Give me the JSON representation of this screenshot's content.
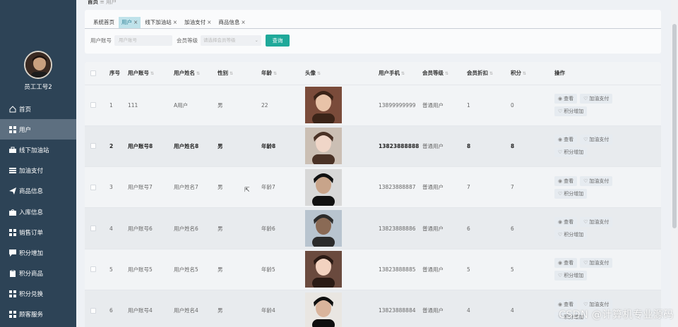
{
  "breadcrumb": {
    "home": "首页",
    "separator": "≡",
    "current": "用户"
  },
  "sidebar": {
    "username": "员工工号2",
    "items": [
      {
        "label": "首页",
        "icon": "home-icon",
        "active": false
      },
      {
        "label": "用户",
        "icon": "grid-icon",
        "active": true
      },
      {
        "label": "线下加油站",
        "icon": "briefcase-icon",
        "active": false
      },
      {
        "label": "加油支付",
        "icon": "list-icon",
        "active": false
      },
      {
        "label": "商品信息",
        "icon": "send-icon",
        "active": false
      },
      {
        "label": "入库信息",
        "icon": "bag-icon",
        "active": false
      },
      {
        "label": "销售订单",
        "icon": "grid-icon",
        "active": false
      },
      {
        "label": "积分增加",
        "icon": "chat-icon",
        "active": false
      },
      {
        "label": "积分商品",
        "icon": "clipboard-icon",
        "active": false
      },
      {
        "label": "积分兑换",
        "icon": "grid-icon",
        "active": false
      },
      {
        "label": "顾客服务",
        "icon": "grid-icon",
        "active": false
      }
    ]
  },
  "tabs": [
    {
      "label": "系统首页",
      "closable": false,
      "active": false
    },
    {
      "label": "用户",
      "closable": true,
      "active": true
    },
    {
      "label": "线下加油站",
      "closable": true,
      "active": false
    },
    {
      "label": "加油支付",
      "closable": true,
      "active": false
    },
    {
      "label": "商品信息",
      "closable": true,
      "active": false
    }
  ],
  "tab_close": "×",
  "search": {
    "account_label": "用户账号",
    "account_placeholder": "用户账号",
    "level_label": "会员等级",
    "level_placeholder": "请选择会员等级",
    "button": "查询"
  },
  "table": {
    "columns": [
      "序号",
      "用户账号",
      "用户姓名",
      "性别",
      "年龄",
      "头像",
      "用户手机",
      "会员等级",
      "会员折扣",
      "积分",
      "操作"
    ],
    "view_label": "查看",
    "pay_label": "加油支付",
    "points_label": "积分增加",
    "rows": [
      {
        "index": "1",
        "account": "111",
        "name": "A用户",
        "gender": "男",
        "age": "22",
        "phone": "13899999999",
        "level": "普通用户",
        "discount": "1",
        "points": "0"
      },
      {
        "index": "2",
        "account": "用户账号8",
        "name": "用户姓名8",
        "gender": "男",
        "age": "年龄8",
        "phone": "13823888888",
        "level": "普通用户",
        "discount": "8",
        "points": "8"
      },
      {
        "index": "3",
        "account": "用户账号7",
        "name": "用户姓名7",
        "gender": "男",
        "age": "年龄7",
        "phone": "13823888887",
        "level": "普通用户",
        "discount": "7",
        "points": "7"
      },
      {
        "index": "4",
        "account": "用户账号6",
        "name": "用户姓名6",
        "gender": "男",
        "age": "年龄6",
        "phone": "13823888886",
        "level": "普通用户",
        "discount": "6",
        "points": "6"
      },
      {
        "index": "5",
        "account": "用户账号5",
        "name": "用户姓名5",
        "gender": "男",
        "age": "年龄5",
        "phone": "13823888885",
        "level": "普通用户",
        "discount": "5",
        "points": "5"
      },
      {
        "index": "6",
        "account": "用户账号4",
        "name": "用户姓名4",
        "gender": "男",
        "age": "年龄4",
        "phone": "13823888884",
        "level": "普通用户",
        "discount": "4",
        "points": "4"
      }
    ]
  },
  "watermark": "CSDN @计算机专业源码",
  "colors": {
    "sidebar": "#2d4356",
    "active_tab": "#bfe2ea",
    "search_button": "#1fa99a"
  }
}
